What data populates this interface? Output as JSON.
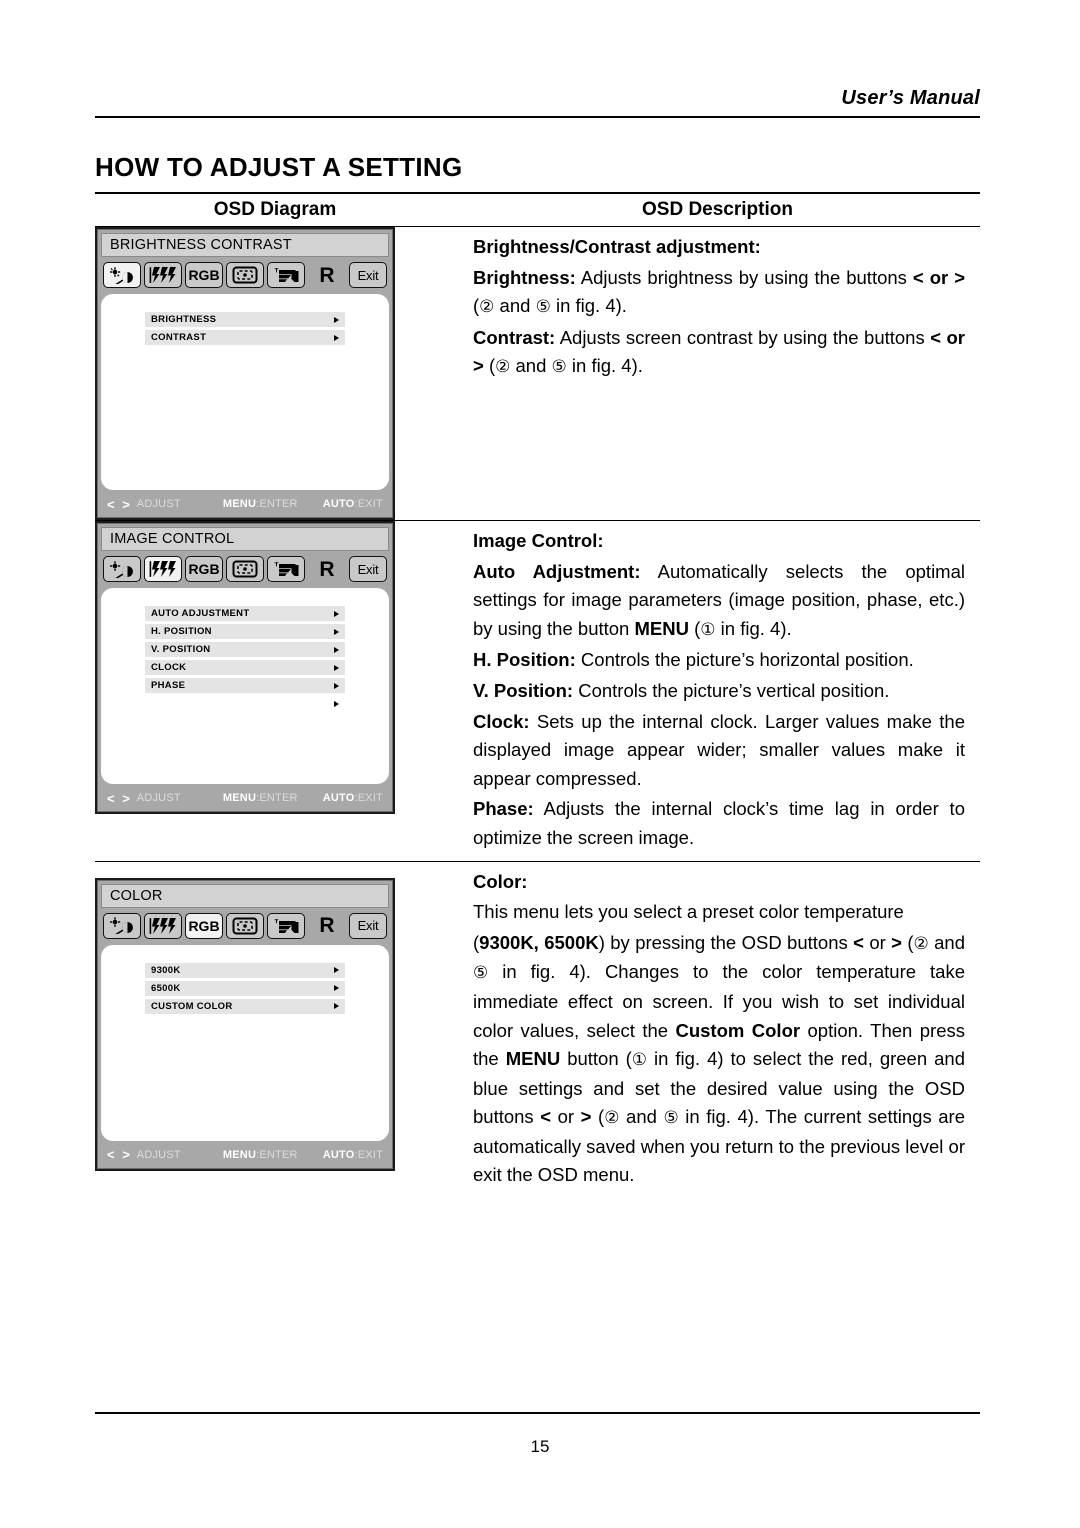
{
  "header": {
    "running_head": "User’s Manual"
  },
  "page_title": "HOW TO ADJUST A SETTING",
  "table": {
    "columns": [
      {
        "key": "diagram",
        "label": "OSD Diagram"
      },
      {
        "key": "description",
        "label": "OSD Description"
      }
    ]
  },
  "osd_icons": [
    {
      "name": "brightness-contrast-icon",
      "glyph": "sun-slash-halfcircle"
    },
    {
      "name": "image-control-icon",
      "glyph": "phase-bars"
    },
    {
      "name": "color-rgb-icon",
      "glyph": "RGB"
    },
    {
      "name": "position-icon",
      "glyph": "screen-frame"
    },
    {
      "name": "tools-language-icon",
      "glyph": "hand-pointer"
    },
    {
      "name": "reset-icon",
      "glyph": "R"
    },
    {
      "name": "exit-icon",
      "glyph": "Exit"
    }
  ],
  "osd_footer": {
    "adjust_keys": "< >",
    "adjust_label": "ADJUST",
    "menu_key": "MENU",
    "menu_sep": ":",
    "menu_label": "ENTER",
    "auto_key": "AUTO",
    "auto_sep": ":",
    "auto_label": "EXIT"
  },
  "osd_panels": [
    {
      "id": "brightness-contrast",
      "title": "BRIGHTNESS CONTRAST",
      "selected_icon_index": 0,
      "items": [
        "BRIGHTNESS",
        "CONTRAST"
      ],
      "extra_arrow": false
    },
    {
      "id": "image-control",
      "title": "IMAGE CONTROL",
      "selected_icon_index": 1,
      "items": [
        "AUTO ADJUSTMENT",
        "H. POSITION",
        "V. POSITION",
        "CLOCK",
        "PHASE"
      ],
      "extra_arrow": true
    },
    {
      "id": "color",
      "title": "COLOR",
      "selected_icon_index": 2,
      "items": [
        "9300K",
        "6500K",
        "CUSTOM COLOR"
      ],
      "extra_arrow": false
    }
  ],
  "descriptions": {
    "brightness_contrast": {
      "heading": "Brightness/Contrast adjustment:",
      "brightness_label": "Brightness:",
      "brightness_text_a": " Adjusts brightness by using the buttons ",
      "brightness_lt_gt": "< or >",
      "brightness_text_b": " (",
      "brightness_num1": "②",
      "brightness_text_c": " and ",
      "brightness_num2": "⑤",
      "brightness_text_d": " in fig. 4).",
      "contrast_label": "Contrast:",
      "contrast_text_a": " Adjusts screen contrast by using the buttons ",
      "contrast_lt_gt": "< or >",
      "contrast_text_b": " (",
      "contrast_num1": "②",
      "contrast_text_c": " and ",
      "contrast_num2": "⑤",
      "contrast_text_d": " in fig. 4)."
    },
    "image_control": {
      "heading": "Image Control:",
      "auto_label": "Auto Adjustment:",
      "auto_text_a": " Automatically selects the optimal settings for image parameters (image position, phase, etc.) by using the button ",
      "auto_menu": "MENU",
      "auto_text_b": " (",
      "auto_num": "①",
      "auto_text_c": " in fig. 4).",
      "hpos_label": "H. Position:",
      "hpos_text": " Controls the picture’s horizontal position.",
      "vpos_label": "V. Position:",
      "vpos_text": " Controls the picture’s vertical position.",
      "clock_label": "Clock:",
      "clock_text": " Sets up the internal clock. Larger values make the displayed image appear wider; smaller values make it appear compressed.",
      "phase_label": "Phase:",
      "phase_text": " Adjusts the internal clock’s time lag in order to optimize the screen image."
    },
    "color": {
      "heading": "Color:",
      "intro": "This menu lets you select a preset color temperature",
      "p2_a": "(",
      "p2_presets": "9300K, 6500K",
      "p2_b": ") by pressing the OSD buttons ",
      "p2_lt": "<",
      "p2_or": " or ",
      "p2_gt": ">",
      "p2_c": " (",
      "p2_num1": "②",
      "p2_d": " and ",
      "p2_num2": "⑤",
      "p2_e": " in fig. 4). Changes to the color temperature take immediate effect on screen. If you wish to set individual color values, select the ",
      "p2_custom": "Custom Color",
      "p2_f": " option. Then press the ",
      "p2_menu": "MENU",
      "p2_g": " button (",
      "p2_num3": "①",
      "p2_h": " in fig. 4) to select the red, green and blue settings and set the desired value using the OSD buttons ",
      "p2_lt2": "<",
      "p2_or2": " or ",
      "p2_gt2": ">",
      "p2_i": " (",
      "p2_num4": "②",
      "p2_j": " and ",
      "p2_num5": "⑤",
      "p2_k": " in fig. 4). The current settings are automatically saved when you return to the previous level or exit the OSD menu."
    }
  },
  "footer": {
    "page_number": "15"
  },
  "colors": {
    "osd_bezel": "#a8a8a8",
    "osd_title_bar": "#d2d2d2",
    "osd_screen": "#ffffff",
    "osd_row": "#e4e4e4",
    "icon_box": "#c9c9c9",
    "icon_box_selected": "#f2f2f2"
  }
}
